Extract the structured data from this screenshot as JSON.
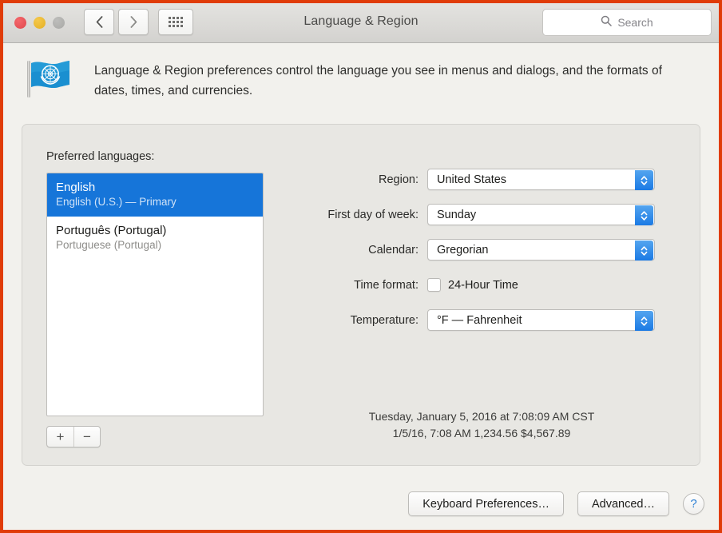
{
  "window": {
    "title": "Language & Region",
    "traffic_lights": [
      "close",
      "minimize",
      "zoom"
    ]
  },
  "toolbar": {
    "back_icon": "chevron-left-icon",
    "forward_icon": "chevron-right-icon",
    "grid_icon": "show-all-grid-icon",
    "search_placeholder": "Search",
    "search_value": "",
    "search_icon": "search-icon"
  },
  "header": {
    "icon": "un-flag-icon",
    "description": "Language & Region preferences control the language you see in menus and dialogs, and the formats of dates, times, and currencies."
  },
  "languages": {
    "label": "Preferred languages:",
    "items": [
      {
        "native": "English",
        "english": "English (U.S.) — Primary",
        "selected": true
      },
      {
        "native": "Português (Portugal)",
        "english": "Portuguese (Portugal)",
        "selected": false
      }
    ],
    "add_label": "+",
    "remove_label": "−"
  },
  "form": {
    "rows": [
      {
        "label": "Region:",
        "value": "United States",
        "type": "popup"
      },
      {
        "label": "First day of week:",
        "value": "Sunday",
        "type": "popup"
      },
      {
        "label": "Calendar:",
        "value": "Gregorian",
        "type": "popup"
      },
      {
        "label": "Time format:",
        "value": "24-Hour Time",
        "type": "checkbox",
        "checked": false
      },
      {
        "label": "Temperature:",
        "value": "°F — Fahrenheit",
        "type": "popup"
      }
    ]
  },
  "samples": {
    "line1": "Tuesday, January 5, 2016 at 7:08:09 AM CST",
    "line2": "1/5/16, 7:08 AM    1,234.56    $4,567.89"
  },
  "footer": {
    "keyboard_prefs": "Keyboard Preferences…",
    "advanced": "Advanced…",
    "help": "?"
  },
  "colors": {
    "accent_blue": "#1675d9",
    "stepper_blue": "#1b7ae4",
    "border_orange": "#e03c08",
    "window_bg": "#f2f1ed",
    "group_bg": "#e8e7e3"
  }
}
